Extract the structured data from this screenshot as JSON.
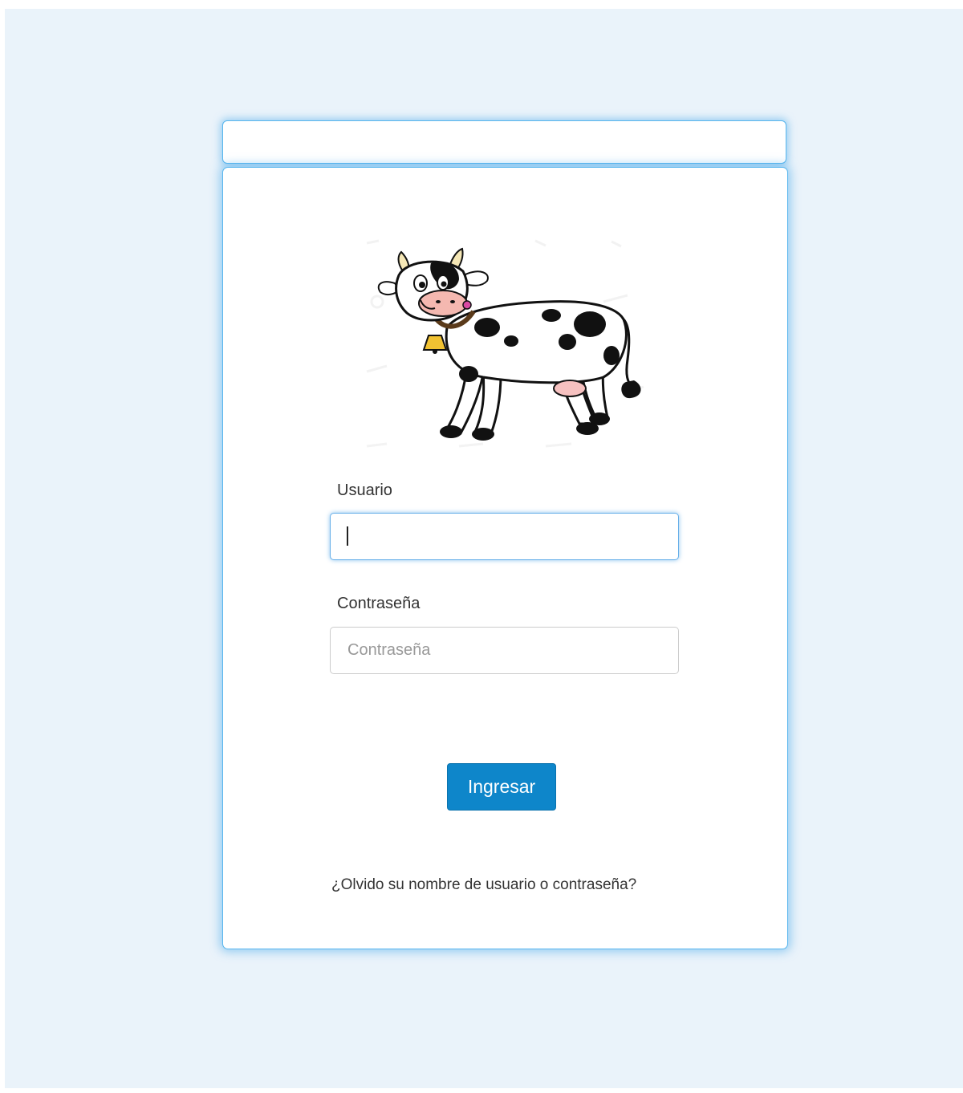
{
  "login": {
    "username_label": "Usuario",
    "username_value": "",
    "password_label": "Contraseña",
    "password_placeholder": "Contraseña",
    "submit_label": "Ingresar",
    "forgot_link": "¿Olvido su nombre de usuario o contraseña?"
  },
  "colors": {
    "page_background": "#eaf3fa",
    "card_border_glow": "#58b6ee",
    "button_primary": "#0e86ca",
    "focus_border": "#66afe9"
  },
  "logo": {
    "icon": "cow-illustration"
  }
}
